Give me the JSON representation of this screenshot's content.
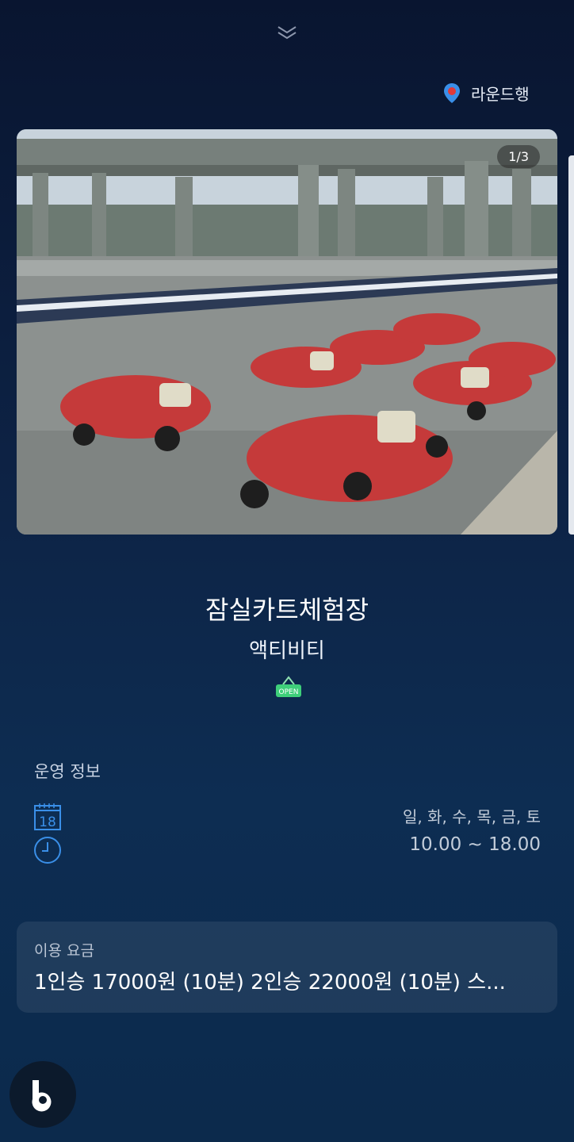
{
  "header": {
    "roundtrip_label": "라운드행",
    "collapse_icon": "chevron-down-double-icon"
  },
  "gallery": {
    "counter": "1/3"
  },
  "place": {
    "name": "잠실카트체험장",
    "category": "액티비티",
    "open_sign_text": "OPEN"
  },
  "operation": {
    "section_label": "운영 정보",
    "calendar_day": "18",
    "days": "일, 화, 수, 목, 금, 토",
    "hours": "10.00 ~ 18.00"
  },
  "fee": {
    "label": "이용 요금",
    "value": "1인승 17000원 (10분) 2인승 22000원 (10분) 스..."
  },
  "colors": {
    "accent": "#3a8fe8",
    "open_green": "#3ecf7a",
    "pin_red": "#e03a3a"
  }
}
